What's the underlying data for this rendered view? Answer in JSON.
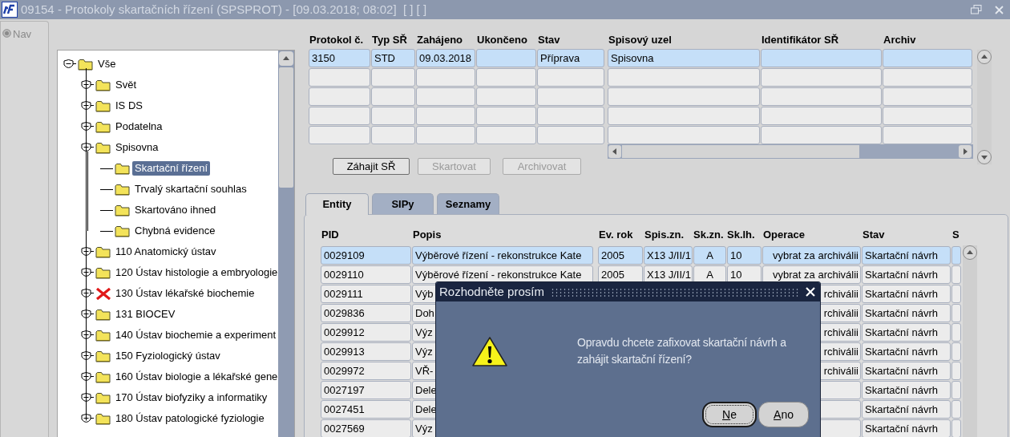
{
  "window": {
    "title": "09154 - Protokoly skartačních řízení (SPSPROT) - [09.03.2018; 08:02]  [ ] [ ]"
  },
  "nav": {
    "label": "Nav"
  },
  "tree": [
    {
      "label": "Vše",
      "kind": "folder",
      "expanded": true,
      "selected": false,
      "children": [
        {
          "label": "Svět",
          "kind": "folder",
          "expanded": false,
          "selected": false
        },
        {
          "label": "IS DS",
          "kind": "folder",
          "expanded": false,
          "selected": false
        },
        {
          "label": "Podatelna",
          "kind": "folder",
          "expanded": false,
          "selected": false
        },
        {
          "label": "Spisovna",
          "kind": "folder",
          "expanded": true,
          "selected": false,
          "children": [
            {
              "label": "Skartační řízení",
              "kind": "folder",
              "selected": true
            },
            {
              "label": "Trvalý skartační souhlas",
              "kind": "folder",
              "selected": false
            },
            {
              "label": "Skartováno ihned",
              "kind": "folder",
              "selected": false
            },
            {
              "label": "Chybná evidence",
              "kind": "folder",
              "selected": false
            }
          ]
        },
        {
          "label": "110 Anatomický ústav",
          "kind": "folder",
          "expanded": false,
          "selected": false
        },
        {
          "label": "120 Ústav histologie a embryologie",
          "kind": "folder",
          "expanded": false,
          "selected": false
        },
        {
          "label": "130 Ústav lékařské biochemie",
          "kind": "error",
          "expanded": false,
          "selected": false
        },
        {
          "label": "131 BIOCEV",
          "kind": "folder",
          "expanded": false,
          "selected": false
        },
        {
          "label": "140 Ústav biochemie a experiment",
          "kind": "folder",
          "expanded": false,
          "selected": false
        },
        {
          "label": "150 Fyziologický ústav",
          "kind": "folder",
          "expanded": false,
          "selected": false
        },
        {
          "label": "160 Ústav biologie a lékařské gene",
          "kind": "folder",
          "expanded": false,
          "selected": false
        },
        {
          "label": "170 Ústav biofyziky a informatiky",
          "kind": "folder",
          "expanded": false,
          "selected": false
        },
        {
          "label": "180 Ústav patologické fyziologie",
          "kind": "folder",
          "expanded": false,
          "selected": false
        }
      ]
    }
  ],
  "protocols": {
    "columns": [
      "Protokol č.",
      "Typ SŘ",
      "Zahájeno",
      "Ukončeno",
      "Stav",
      "Spisový uzel",
      "Identifikátor SŘ",
      "Archiv"
    ],
    "rows": [
      {
        "protokol": "3150",
        "typ": "STD",
        "zahajeno": "09.03.2018",
        "stav": "Příprava",
        "uzel": "Spisovna",
        "selected": true
      }
    ]
  },
  "actions": [
    {
      "label": "Záhajit SŘ",
      "disabled": false
    },
    {
      "label": "Skartovat",
      "disabled": true
    },
    {
      "label": "Archivovat",
      "disabled": true
    }
  ],
  "tabs": [
    {
      "label": "Entity",
      "selected": true
    },
    {
      "label": "SIPy",
      "selected": false
    },
    {
      "label": "Seznamy",
      "selected": false
    }
  ],
  "entities": {
    "columns": [
      "PID",
      "Popis",
      "Ev. rok",
      "Spis.zn.",
      "Sk.zn.",
      "Sk.lh.",
      "Operace",
      "Stav",
      "S"
    ],
    "rows": [
      {
        "pid": "0029109",
        "popis": "Výběrové řízení - rekonstrukce Kate",
        "rok": "2005",
        "spis": "X13 J/II/1",
        "skzn": "A",
        "sklh": "10",
        "operace": "vybrat za archiválii",
        "stav": "Skartační návrh",
        "selected": true
      },
      {
        "pid": "0029110",
        "popis": "Výběrové řízení - rekonstrukce Kate",
        "rok": "2005",
        "spis": "X13 J/II/1",
        "skzn": "A",
        "sklh": "10",
        "operace": "vybrat za archiválii",
        "stav": "Skartační návrh",
        "selected": false
      },
      {
        "pid": "0029111",
        "popis": "Výb",
        "operace": "rchiválii",
        "stav": "Skartační návrh",
        "selected": false
      },
      {
        "pid": "0029836",
        "popis": "Doh",
        "operace": "rchiválii",
        "stav": "Skartační návrh",
        "selected": false
      },
      {
        "pid": "0029912",
        "popis": "Výz",
        "operace": "rchiválii",
        "stav": "Skartační návrh",
        "selected": false
      },
      {
        "pid": "0029913",
        "popis": "Výz",
        "operace": "rchiválii",
        "stav": "Skartační návrh",
        "selected": false
      },
      {
        "pid": "0029972",
        "popis": "VŘ-",
        "operace": "rchiválii",
        "stav": "Skartační návrh",
        "selected": false
      },
      {
        "pid": "0027197",
        "popis": "Dele",
        "stav": "Skartační návrh",
        "selected": false
      },
      {
        "pid": "0027451",
        "popis": "Dele",
        "stav": "Skartační návrh",
        "selected": false
      },
      {
        "pid": "0027569",
        "popis": "Výz",
        "stav": "Skartační návrh",
        "selected": false
      }
    ]
  },
  "dialog": {
    "title": "Rozhodněte prosím",
    "message": "Opravdu chcete zafixovat skartační návrh a zahájit skartační řízení?",
    "buttons": [
      {
        "label": "Ne",
        "focused": true
      },
      {
        "label": "Ano",
        "focused": false
      }
    ]
  }
}
